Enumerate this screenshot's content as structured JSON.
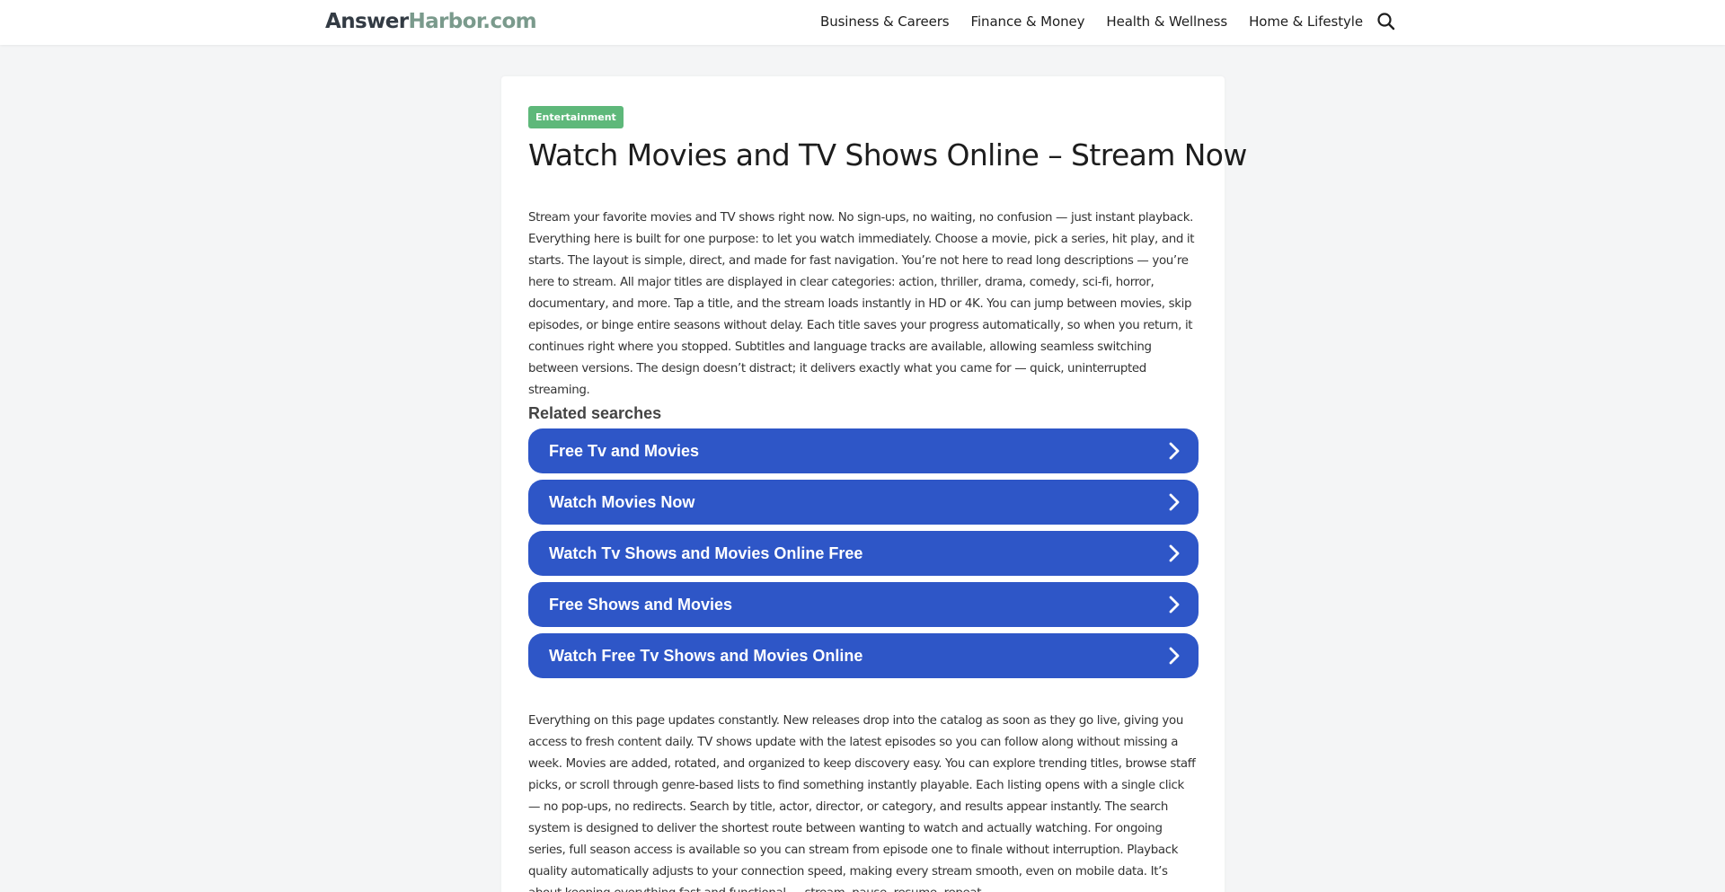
{
  "header": {
    "logo_part1": "Answer",
    "logo_part2": "Harbor.com",
    "nav": [
      {
        "label": "Business & Careers"
      },
      {
        "label": "Finance & Money"
      },
      {
        "label": "Health & Wellness"
      },
      {
        "label": "Home & Lifestyle"
      }
    ],
    "search_icon": "search-icon"
  },
  "article": {
    "category": "Entertainment",
    "title": "Watch Movies and TV Shows Online – Stream Now",
    "intro": "Stream your favorite movies and TV shows right now. No sign-ups, no waiting, no confusion — just instant playback. Everything here is built for one purpose: to let you watch immediately. Choose a movie, pick a series, hit play, and it starts. The layout is simple, direct, and made for fast navigation. You’re not here to read long descriptions — you’re here to stream. All major titles are displayed in clear categories: action, thriller, drama, comedy, sci-fi, horror, documentary, and more. Tap a title, and the stream loads instantly in HD or 4K. You can jump between movies, skip episodes, or binge entire seasons without delay. Each title saves your progress automatically, so when you return, it continues right where you stopped. Subtitles and language tracks are available, allowing seamless switching between versions. The design doesn’t distract; it delivers exactly what you came for — quick, uninterrupted streaming.",
    "related_heading": "Related searches",
    "related": [
      {
        "label": "Free Tv and Movies"
      },
      {
        "label": "Watch Movies Now"
      },
      {
        "label": "Watch Tv Shows and Movies Online Free"
      },
      {
        "label": "Free Shows and Movies"
      },
      {
        "label": "Watch Free Tv Shows and Movies Online"
      }
    ],
    "body": "Everything on this page updates constantly. New releases drop into the catalog as soon as they go live, giving you access to fresh content daily. TV shows update with the latest episodes so you can follow along without missing a week. Movies are added, rotated, and organized to keep discovery easy. You can explore trending titles, browse staff picks, or scroll through genre-based lists to find something instantly playable. Each listing opens with a single click — no pop-ups, no redirects. Search by title, actor, director, or category, and results appear instantly. The search system is designed to deliver the shortest route between wanting to watch and actually watching. For ongoing series, full season access is available so you can stream from episode one to finale without interruption. Playback quality automatically adjusts to your connection speed, making every stream smooth, even on mobile data. It’s about keeping everything fast and functional — stream, pause, resume, repeat."
  },
  "colors": {
    "badge": "#5eb87a",
    "related_button": "#2e56c7",
    "logo_accent": "#7a9a8c",
    "background": "#f4f5f6"
  }
}
